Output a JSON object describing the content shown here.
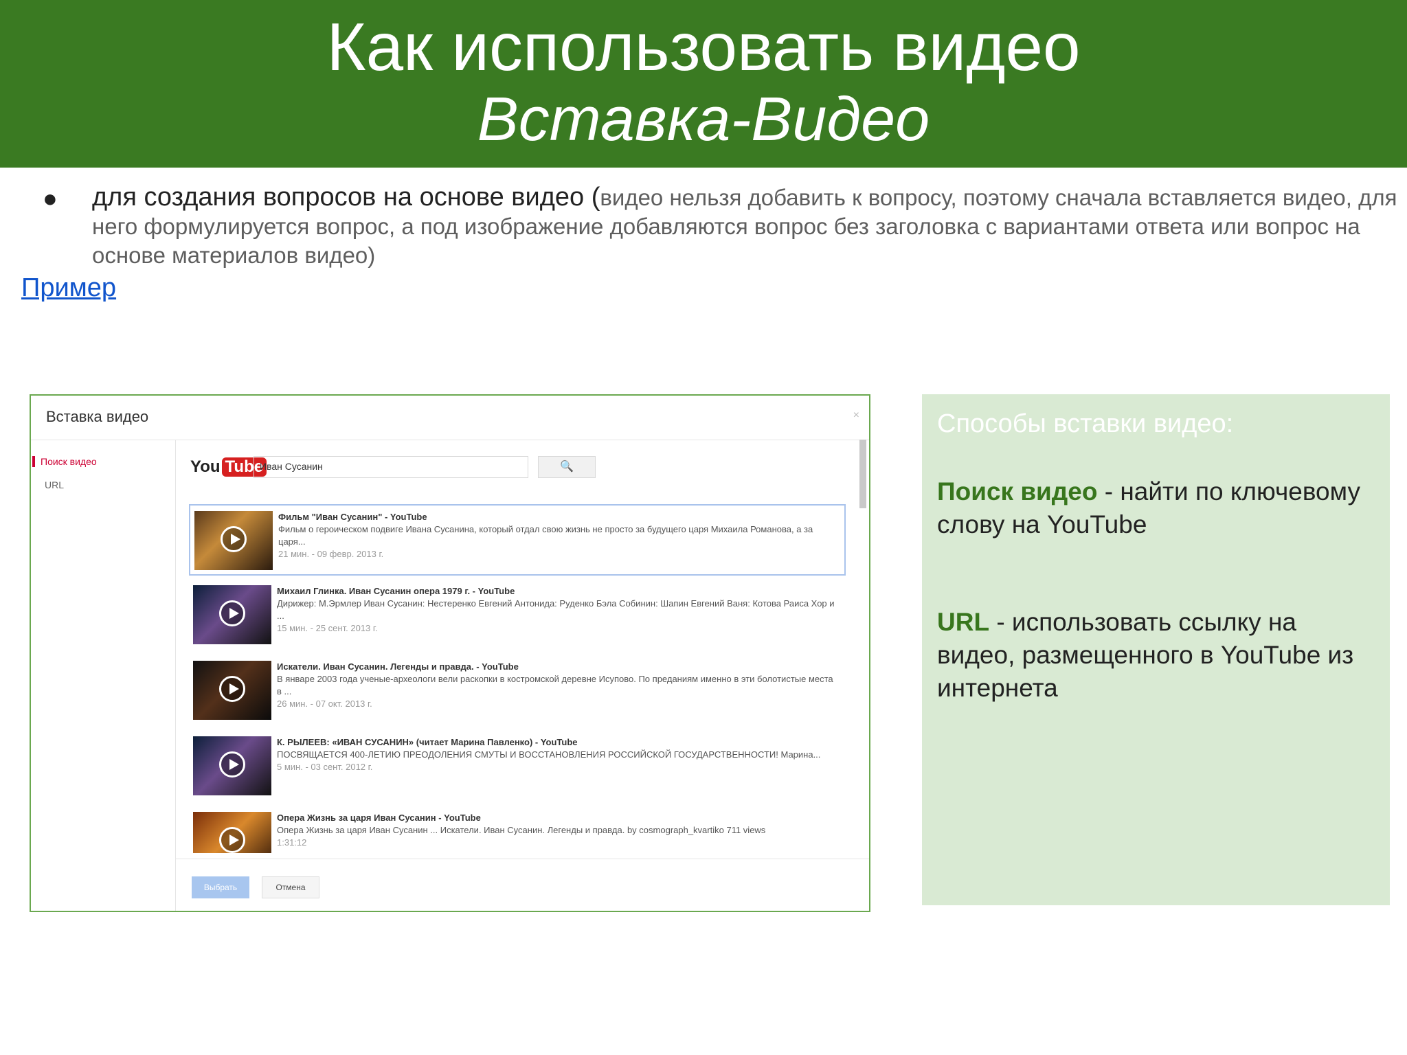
{
  "header": {
    "title": "Как использовать видео",
    "subtitle": "Вставка-Видео"
  },
  "bullet": {
    "lead": "для создания вопросов на основе видео (",
    "rest": "видео нельзя добавить к вопросу, поэтому сначала вставляется видео, для него формулируется вопрос, а под изображение добавляются вопрос без заголовка с  вариантами ответа или вопрос на основе материалов видео)"
  },
  "example_link": "Пример",
  "dialog": {
    "title": "Вставка видео",
    "close": "×",
    "tabs": [
      "Поиск видео",
      "URL"
    ],
    "logo_you": "You",
    "logo_tube": "Tube",
    "search_value": "Иван Сусанин",
    "search_icon": "magnifier-icon",
    "results": [
      {
        "title": "Фильм \"Иван Сусанин\" - YouTube",
        "desc": "Фильм о героическом подвиге Ивана Сусанина, который отдал свою жизнь не просто за будущего царя Михаила Романова, а за царя...",
        "meta": "21 мин. - 09 февр. 2013 г."
      },
      {
        "title": "Михаил Глинка. Иван Сусанин опера 1979 г. - YouTube",
        "desc": "Дирижер: М.Эрмлер Иван Сусанин: Нестеренко Евгений Антонида: Руденко Бэла Собинин: Шапин Евгений Ваня: Котова Раиса Хор и ...",
        "meta": "15 мин. - 25 сент. 2013 г."
      },
      {
        "title": "Искатели. Иван Сусанин. Легенды и правда. - YouTube",
        "desc": "В январе 2003 года ученые-археологи вели раскопки в костромской деревне Исупово. По преданиям именно в эти болотистые места в ...",
        "meta": "26 мин. - 07 окт. 2013 г."
      },
      {
        "title": "К. РЫЛЕЕВ: «ИВАН СУСАНИН» (читает Марина Павленко) - YouTube",
        "desc": "ПОСВЯЩАЕТСЯ 400-ЛЕТИЮ ПРЕОДОЛЕНИЯ СМУТЫ И ВОССТАНОВЛЕНИЯ РОССИЙСКОЙ ГОСУДАРСТВЕННОСТИ! Марина...",
        "meta": "5 мин. - 03 сент. 2012 г."
      },
      {
        "title": "Опера Жизнь за царя Иван Сусанин - YouTube",
        "desc": "Опера Жизнь за царя Иван Сусанин ... Искатели. Иван Сусанин. Легенды и правда. by cosmograph_kvartiko 711 views",
        "meta": "1:31:12"
      }
    ],
    "select_button": "Выбрать",
    "cancel_button": "Отмена"
  },
  "panel": {
    "title": "Способы вставки видео:",
    "item1_term": "Поиск видео",
    "item1_text": " - найти по ключевому слову  на YouTube",
    "item2_term": "URL",
    "item2_text": " - использовать ссылку на видео, размещенного в YouTube из интернета"
  },
  "colors": {
    "header_bg": "#3a7a22",
    "panel_bg": "#d9ead3",
    "term_green": "#38761d",
    "link_blue": "#1155cc"
  }
}
